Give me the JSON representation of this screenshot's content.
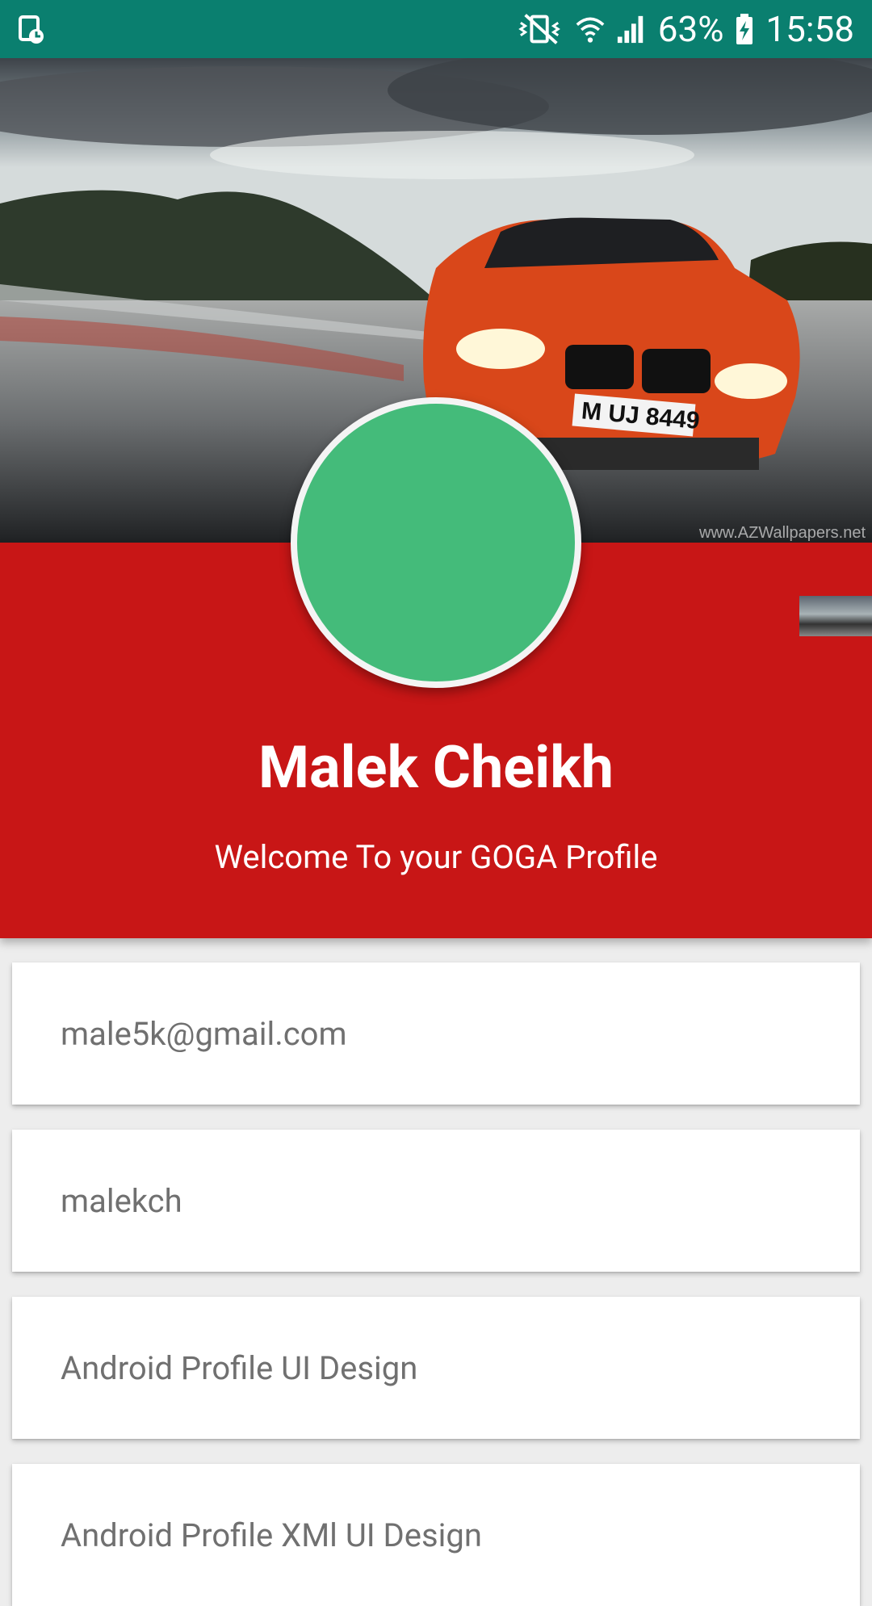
{
  "status_bar": {
    "battery": "63%",
    "time": "15:58",
    "icons": [
      "screenshot-icon",
      "vibrate-icon",
      "wifi-icon",
      "signal-icon",
      "battery-charging-icon"
    ]
  },
  "header": {
    "image": "red-sports-car-photo",
    "watermark": "www.AZWallpapers.net"
  },
  "profile": {
    "name": "Malek Cheikh",
    "subtitle": "Welcome To your GOGA Profile",
    "avatar_color": "#44bb7a",
    "banner_color": "#c81616"
  },
  "fields": [
    {
      "value": "male5k@gmail.com"
    },
    {
      "value": "malekch"
    },
    {
      "value": "Android Profile UI Design"
    },
    {
      "value": "Android Profile XMl UI Design"
    }
  ],
  "colors": {
    "status_bar": "#0a7f6f",
    "background": "#ededed",
    "card_text": "#707070"
  }
}
